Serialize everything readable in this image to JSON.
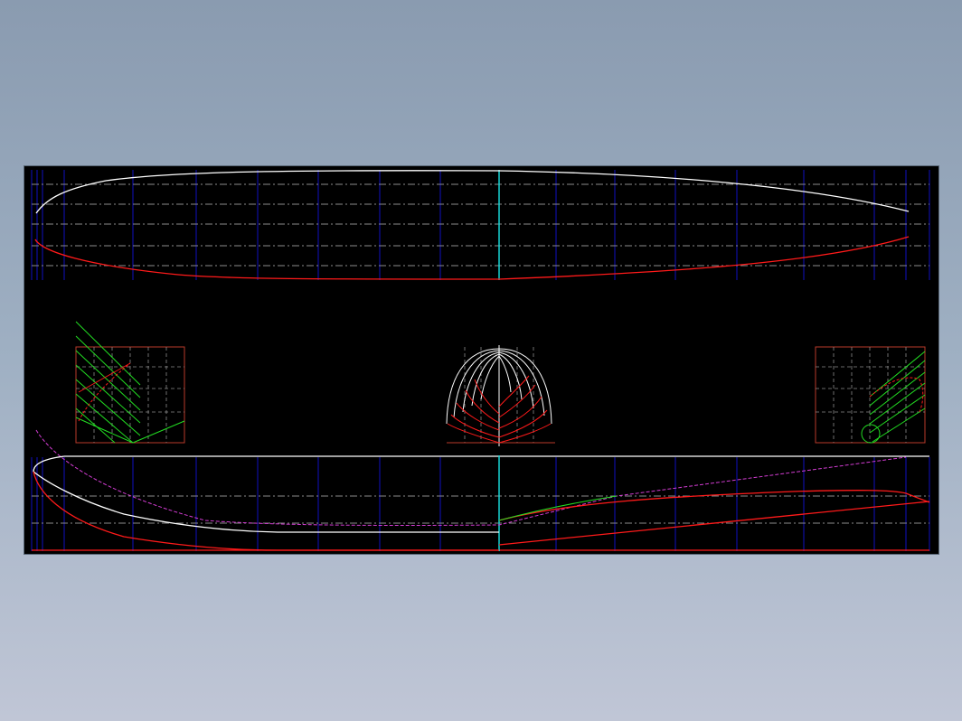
{
  "app": {
    "title": ""
  },
  "drawing": {
    "background": "#000000",
    "colors": {
      "white": "#ffffff",
      "red": "#ff1a1a",
      "green": "#22dd22",
      "blue": "#1010c0",
      "cyan": "#19d6d6",
      "magenta": "#d23cd2",
      "grid_dash": "#8c8c8c",
      "box": "#b83a2a"
    },
    "views": [
      {
        "name": "half-breadth-plan"
      },
      {
        "name": "bow-section-box"
      },
      {
        "name": "body-plan"
      },
      {
        "name": "stern-section-box"
      },
      {
        "name": "profile-view"
      }
    ]
  }
}
